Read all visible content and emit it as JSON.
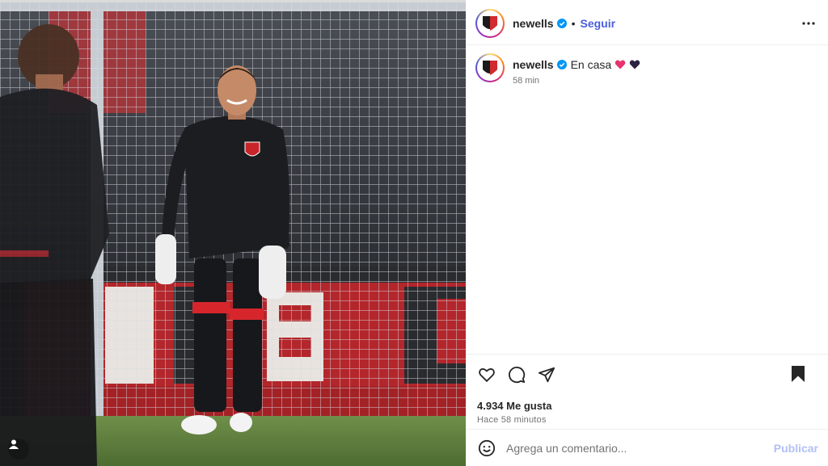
{
  "post": {
    "username": "newells",
    "follow_label": "Seguir",
    "separator": "•",
    "caption_text": "En casa",
    "caption_emojis": [
      "heart-red",
      "heart-black"
    ],
    "caption_time": "58 min",
    "likes": "4.934 Me gusta",
    "posted_ago": "Hace 58 minutos",
    "verified": true
  },
  "comment": {
    "placeholder": "Agrega un comentario...",
    "publish_label": "Publicar"
  },
  "icons": {
    "like": "heart-outline-icon",
    "comment": "comment-bubble-icon",
    "share": "paper-plane-icon",
    "save": "bookmark-filled-icon",
    "more": "ellipsis-icon",
    "emoji": "smiley-icon",
    "tag": "user-tag-icon"
  },
  "colors": {
    "accent": "#4a5edb",
    "publish_disabled": "#b2c0f5",
    "verified": "#0095f6",
    "heart_red": "#e8336d",
    "heart_dark": "#2b2340"
  }
}
